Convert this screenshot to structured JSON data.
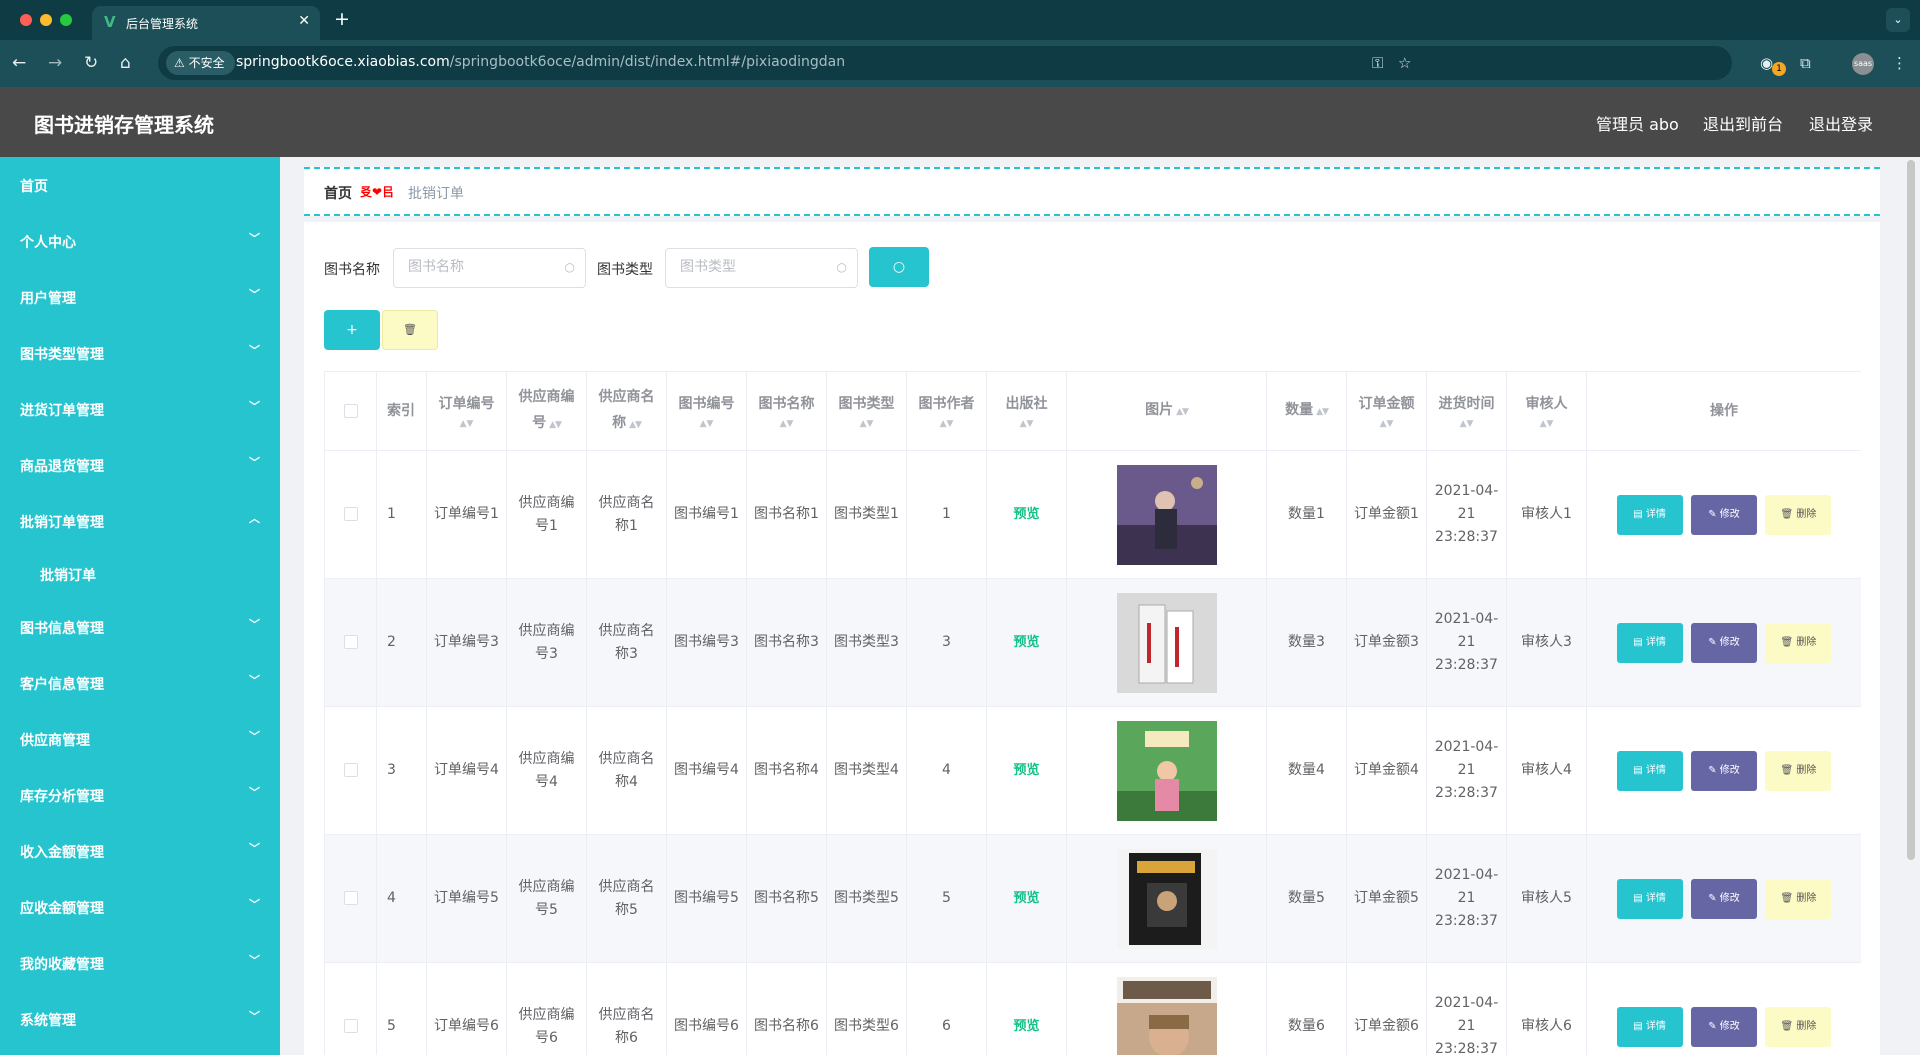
{
  "browser": {
    "tab_title": "后台管理系统",
    "tab_favicon": "V",
    "new_tab_symbol": "+",
    "security_label": "不安全",
    "url_host": "springbootk6oce.xiaobias.com",
    "url_path": "/springbootk6oce/admin/dist/index.html#/pixiaodingdan",
    "extension_badge": "1",
    "profile_label": "saas"
  },
  "header": {
    "title": "图书进销存管理系统",
    "user": "管理员 abo",
    "to_front": "退出到前台",
    "logout": "退出登录"
  },
  "sidebar": {
    "items": [
      {
        "label": "首页",
        "expandable": false
      },
      {
        "label": "个人中心",
        "expandable": true
      },
      {
        "label": "用户管理",
        "expandable": true
      },
      {
        "label": "图书类型管理",
        "expandable": true
      },
      {
        "label": "进货订单管理",
        "expandable": true
      },
      {
        "label": "商品退货管理",
        "expandable": true
      },
      {
        "label": "批销订单管理",
        "expandable": true,
        "expanded": true
      },
      {
        "label": "批销订单",
        "sub": true
      },
      {
        "label": "图书信息管理",
        "expandable": true
      },
      {
        "label": "客户信息管理",
        "expandable": true
      },
      {
        "label": "供应商管理",
        "expandable": true
      },
      {
        "label": "库存分析管理",
        "expandable": true
      },
      {
        "label": "收入金额管理",
        "expandable": true
      },
      {
        "label": "应收金额管理",
        "expandable": true
      },
      {
        "label": "我的收藏管理",
        "expandable": true
      },
      {
        "label": "系统管理",
        "expandable": true
      }
    ]
  },
  "breadcrumb": {
    "home": "首页",
    "separator": "㕛❤㠯",
    "current": "批销订单"
  },
  "search": {
    "book_name_label": "图书名称",
    "book_name_placeholder": "图书名称",
    "book_type_label": "图书类型",
    "book_type_placeholder": "图书类型"
  },
  "table": {
    "headers": {
      "index": "索引",
      "order_no": "订单编号",
      "supplier_no": "供应商编号",
      "supplier_name": "供应商名称",
      "book_no": "图书编号",
      "book_name": "图书名称",
      "book_type": "图书类型",
      "author": "图书作者",
      "publisher": "出版社",
      "image": "图片",
      "quantity": "数量",
      "amount": "订单金额",
      "purchase_time": "进货时间",
      "reviewer": "审核人",
      "actions": "操作"
    },
    "rows": [
      {
        "index": "1",
        "order_no": "订单编号1",
        "supplier_no": "供应商编号1",
        "supplier_name": "供应商名称1",
        "book_no": "图书编号1",
        "book_name": "图书名称1",
        "book_type": "图书类型1",
        "author": "1",
        "publisher": "预览",
        "quantity": "数量1",
        "amount": "订单金额1",
        "purchase_time": "2021-04-21 23:28:37",
        "reviewer": "审核人1"
      },
      {
        "index": "2",
        "order_no": "订单编号3",
        "supplier_no": "供应商编号3",
        "supplier_name": "供应商名称3",
        "book_no": "图书编号3",
        "book_name": "图书名称3",
        "book_type": "图书类型3",
        "author": "3",
        "publisher": "预览",
        "quantity": "数量3",
        "amount": "订单金额3",
        "purchase_time": "2021-04-21 23:28:37",
        "reviewer": "审核人3"
      },
      {
        "index": "3",
        "order_no": "订单编号4",
        "supplier_no": "供应商编号4",
        "supplier_name": "供应商名称4",
        "book_no": "图书编号4",
        "book_name": "图书名称4",
        "book_type": "图书类型4",
        "author": "4",
        "publisher": "预览",
        "quantity": "数量4",
        "amount": "订单金额4",
        "purchase_time": "2021-04-21 23:28:37",
        "reviewer": "审核人4"
      },
      {
        "index": "4",
        "order_no": "订单编号5",
        "supplier_no": "供应商编号5",
        "supplier_name": "供应商名称5",
        "book_no": "图书编号5",
        "book_name": "图书名称5",
        "book_type": "图书类型5",
        "author": "5",
        "publisher": "预览",
        "quantity": "数量5",
        "amount": "订单金额5",
        "purchase_time": "2021-04-21 23:28:37",
        "reviewer": "审核人5"
      },
      {
        "index": "5",
        "order_no": "订单编号6",
        "supplier_no": "供应商编号6",
        "supplier_name": "供应商名称6",
        "book_no": "图书编号6",
        "book_name": "图书名称6",
        "book_type": "图书类型6",
        "author": "6",
        "publisher": "预览",
        "quantity": "数量6",
        "amount": "订单金额6",
        "purchase_time": "2021-04-21 23:28:37",
        "reviewer": "审核人6"
      }
    ],
    "action_labels": {
      "detail": "详情",
      "edit": "修改",
      "delete": "删除"
    }
  },
  "colors": {
    "accent": "#25c4cf",
    "edit": "#6766a5",
    "delete": "#fcfbc5",
    "header_bg": "#494949",
    "preview_text": "#13c189"
  }
}
